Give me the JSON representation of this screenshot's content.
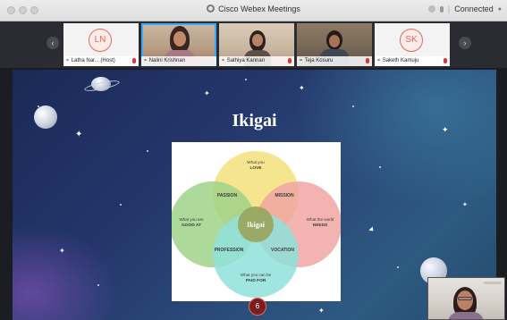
{
  "window": {
    "title": "Cisco Webex Meetings",
    "status": "Connected"
  },
  "participants": [
    {
      "name": "Latha Nar...",
      "role": "(Host)",
      "initials": "LN",
      "video": false,
      "muted": true
    },
    {
      "name": "Nalini Krishnan",
      "video": true,
      "muted": false,
      "active": true
    },
    {
      "name": "Sathiya Kannan",
      "video": true,
      "muted": true
    },
    {
      "name": "Teja Kosuru",
      "video": true,
      "muted": true
    },
    {
      "name": "Saketh Kamuju",
      "initials": "SK",
      "video": false,
      "muted": true
    }
  ],
  "presentation": {
    "heading": "Ikigai",
    "venn": {
      "top": {
        "line1": "What you",
        "line2": "LOVE"
      },
      "left": {
        "line1": "What you are",
        "line2": "GOOD AT"
      },
      "right": {
        "line1": "What the world",
        "line2": "NEEDS"
      },
      "bottom": {
        "line1": "What you can be",
        "line2": "PAID FOR"
      },
      "passion": "PASSION",
      "mission": "MISSION",
      "profession": "PROFESSION",
      "vocation": "VOCATION",
      "center": "Ikigai"
    },
    "page_number": "6"
  },
  "colors": {
    "love": "#f3e07a",
    "needs": "#f0a6a3",
    "good_at": "#9fd28a",
    "paid_for": "#8fe0db",
    "center": "#9aa35a",
    "avatar_accent": "#e26a5a",
    "active_tile": "#3fa5f5"
  }
}
